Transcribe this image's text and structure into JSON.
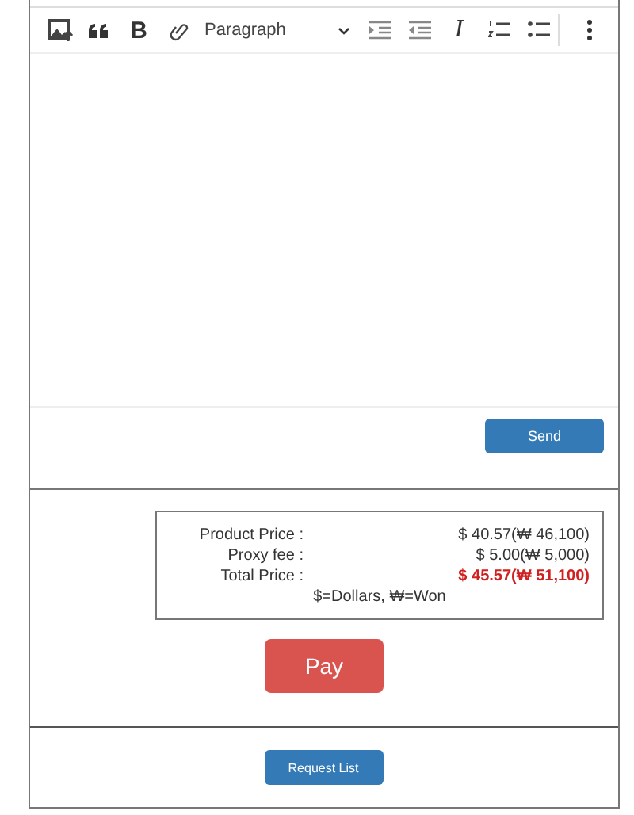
{
  "toolbar": {
    "items": [
      {
        "kind": "image"
      },
      {
        "kind": "quote"
      },
      {
        "kind": "bold",
        "label": "B"
      },
      {
        "kind": "link"
      },
      {
        "kind": "format",
        "label": "Paragraph"
      },
      {
        "kind": "indent"
      },
      {
        "kind": "outdent"
      },
      {
        "kind": "italic",
        "label": "I"
      },
      {
        "kind": "numbered"
      },
      {
        "kind": "bulleted"
      },
      {
        "kind": "more"
      }
    ]
  },
  "send_button": "Send",
  "price_summary": {
    "rows": [
      {
        "label": "Product Price :",
        "value": "$ 40.57(₩ 46,100)",
        "kind": "normal"
      },
      {
        "label": "Proxy fee :",
        "value": "$ 5.00(₩ 5,000)",
        "kind": "normal"
      },
      {
        "label": "Total Price :",
        "value": "$ 45.57(₩ 51,100)",
        "kind": "total"
      }
    ],
    "legend": "$=Dollars, ₩=Won"
  },
  "pay_button": "Pay",
  "request_list_button": "Request List"
}
